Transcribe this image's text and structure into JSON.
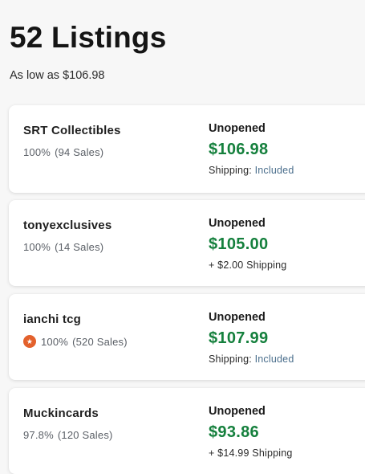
{
  "header": {
    "title": "52 Listings",
    "subtitle": "As low as $106.98"
  },
  "listings": [
    {
      "seller": "SRT Collectibles",
      "rating": "100%",
      "sales": "(94 Sales)",
      "badge": null,
      "condition": "Unopened",
      "price": "$106.98",
      "shipping_prefix": "Shipping: ",
      "shipping_value": "Included"
    },
    {
      "seller": "tonyexclusives",
      "rating": "100%",
      "sales": "(14 Sales)",
      "badge": null,
      "condition": "Unopened",
      "price": "$105.00",
      "shipping_prefix": "+ $2.00 Shipping",
      "shipping_value": ""
    },
    {
      "seller": "ianchi tcg",
      "rating": "100%",
      "sales": "(520 Sales)",
      "badge": "star-seller-badge-icon",
      "condition": "Unopened",
      "price": "$107.99",
      "shipping_prefix": "Shipping: ",
      "shipping_value": "Included"
    },
    {
      "seller": "Muckincards",
      "rating": "97.8%",
      "sales": "(120 Sales)",
      "badge": null,
      "condition": "Unopened",
      "price": "$93.86",
      "shipping_prefix": "+ $14.99 Shipping",
      "shipping_value": ""
    }
  ],
  "colors": {
    "price": "#15803d",
    "badge": "#e3612c",
    "included": "#4a6e8c"
  }
}
